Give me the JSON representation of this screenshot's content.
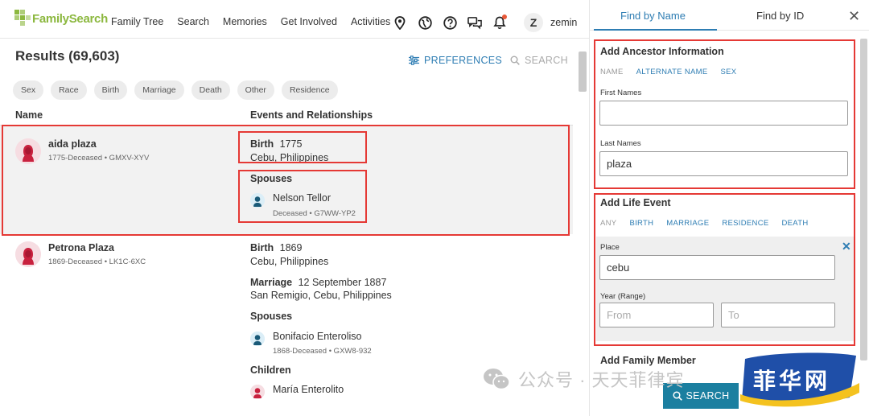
{
  "nav": {
    "logo": "FamilySearch",
    "links": [
      "Family Tree",
      "Search",
      "Memories",
      "Get Involved",
      "Activities"
    ],
    "icons": [
      "location-pin-icon",
      "globe-icon",
      "help-icon",
      "chat-icon",
      "bell-icon"
    ],
    "avatar_initial": "Z",
    "username": "zemin"
  },
  "results": {
    "title": "Results (69,603)",
    "preferences_label": "PREFERENCES",
    "search_label": "SEARCH",
    "filters": [
      "Sex",
      "Race",
      "Birth",
      "Marriage",
      "Death",
      "Other",
      "Residence"
    ],
    "col_name": "Name",
    "col_events": "Events and Relationships",
    "rows": [
      {
        "name": "aida plaza",
        "meta": "1775-Deceased • GMXV-XYV",
        "birth_label": "Birth",
        "birth_year": "1775",
        "birth_place": "Cebu, Philippines",
        "spouses_label": "Spouses",
        "spouse_name": "Nelson Tellor",
        "spouse_meta": "Deceased • G7WW-YP2"
      },
      {
        "name": "Petrona Plaza",
        "meta": "1869-Deceased • LK1C-6XC",
        "birth_label": "Birth",
        "birth_year": "1869",
        "birth_place": "Cebu, Philippines",
        "marriage_label": "Marriage",
        "marriage_date": "12 September 1887",
        "marriage_place": "San Remigio, Cebu, Philippines",
        "spouses_label": "Spouses",
        "spouse_name": "Bonifacio Enteroliso",
        "spouse_meta": "1868-Deceased • GXW8-932",
        "children_label": "Children",
        "child_name": "María Enterolito"
      }
    ]
  },
  "panel": {
    "tab_name": "Find by Name",
    "tab_id": "Find by ID",
    "close": "✕",
    "ancestor_title": "Add Ancestor Information",
    "ancestor_tabs": [
      "NAME",
      "ALTERNATE NAME",
      "SEX"
    ],
    "first_names_label": "First Names",
    "first_names_value": "",
    "last_names_label": "Last Names",
    "last_names_value": "plaza",
    "life_event_title": "Add Life Event",
    "life_event_tabs": [
      "ANY",
      "BIRTH",
      "MARRIAGE",
      "RESIDENCE",
      "DEATH"
    ],
    "place_label": "Place",
    "place_value": "cebu",
    "year_label": "Year (Range)",
    "from_placeholder": "From",
    "to_placeholder": "To",
    "family_title": "Add Family Member",
    "search_button": "SEARCH"
  },
  "watermark": {
    "text": "公众号 · 天天菲律宾",
    "badge": "菲华网"
  },
  "colors": {
    "accent": "#2e7db3",
    "highlight_box": "#e53935",
    "logo_green": "#8cb83f",
    "search_button": "#1b7fa0"
  }
}
